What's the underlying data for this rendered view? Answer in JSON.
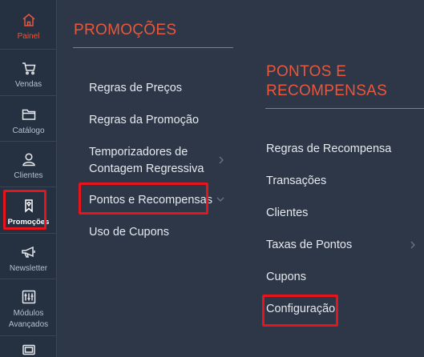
{
  "rail": {
    "items": [
      {
        "label": "Painel",
        "icon": "home-icon"
      },
      {
        "label": "Vendas",
        "icon": "cart-icon"
      },
      {
        "label": "Catálogo",
        "icon": "folder-icon"
      },
      {
        "label": "Clientes",
        "icon": "user-icon"
      },
      {
        "label": "Promoções",
        "icon": "tag-icon"
      },
      {
        "label": "Newsletter",
        "icon": "megaphone-icon"
      },
      {
        "label": "Módulos Avançados",
        "icon": "modules-icon"
      },
      {
        "label": "",
        "icon": "monitor-icon"
      }
    ]
  },
  "promotions_panel": {
    "title": "PROMOÇÕES",
    "items": [
      {
        "label": "Regras de Preços"
      },
      {
        "label": "Regras da Promoção"
      },
      {
        "label": "Temporizadores de Contagem Regressiva",
        "line1": "Temporizadores de",
        "line2": "Contagem Regressiva"
      },
      {
        "label": "Pontos e Recompensas"
      },
      {
        "label": "Uso de Cupons"
      }
    ]
  },
  "rewards_panel": {
    "title_line1": "PONTOS E",
    "title_line2": "RECOMPENSAS",
    "items": [
      {
        "label": "Regras de Recompensa"
      },
      {
        "label": "Transações"
      },
      {
        "label": "Clientes"
      },
      {
        "label": "Taxas de Pontos"
      },
      {
        "label": "Cupons"
      },
      {
        "label": "Configuração"
      }
    ]
  },
  "colors": {
    "accent": "#e9573c",
    "highlight_box": "#e8141c",
    "background": "#2d3747",
    "rail_background": "#253040"
  }
}
